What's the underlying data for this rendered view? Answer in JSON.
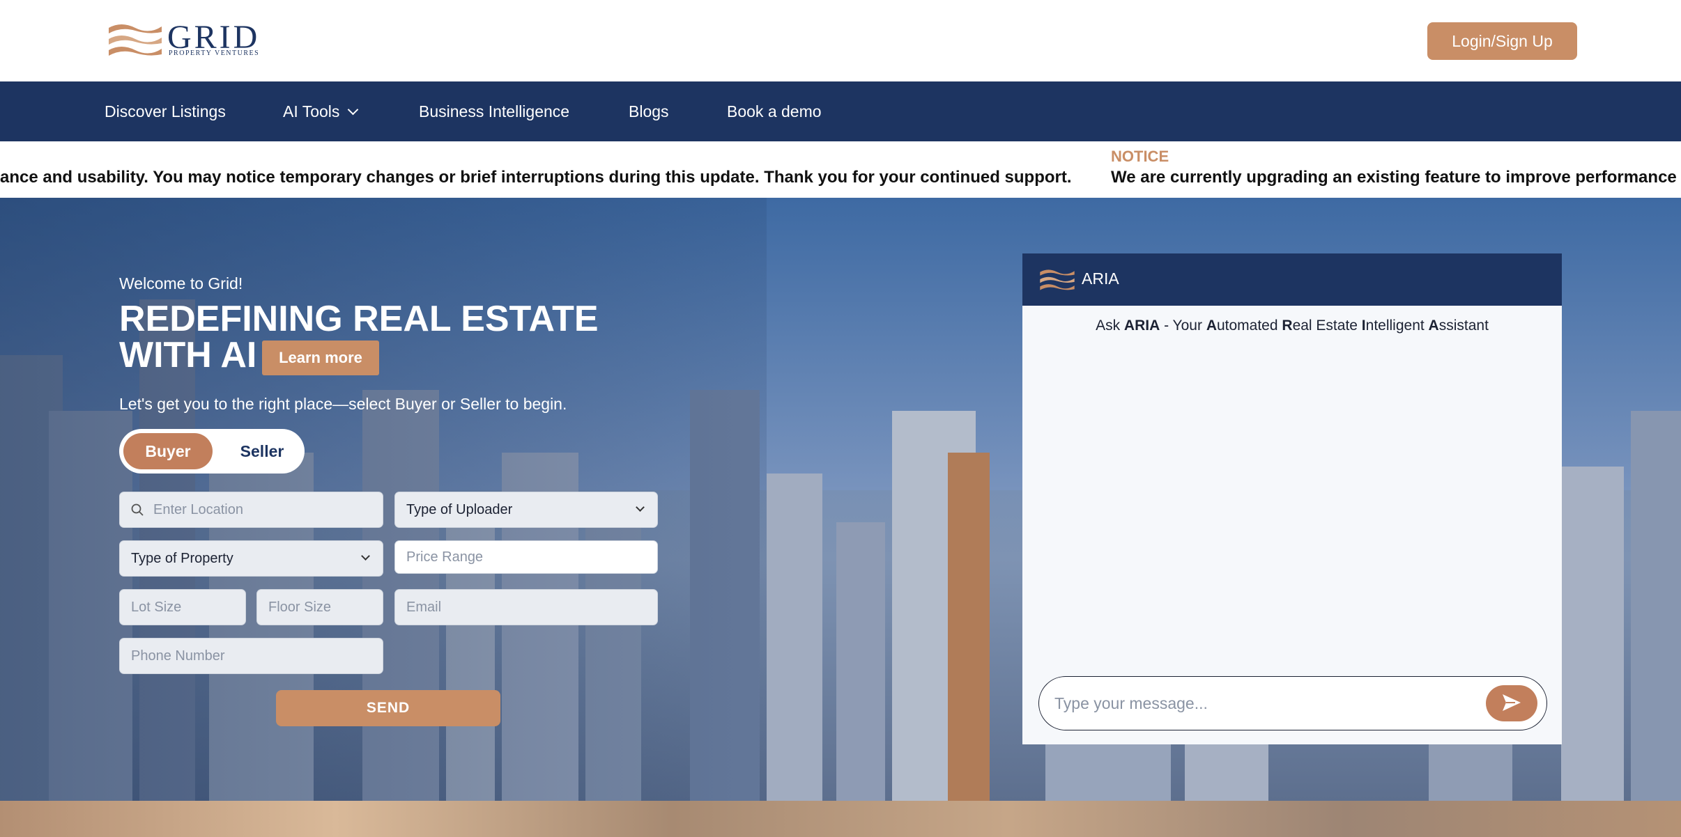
{
  "header": {
    "logo_text": "GRID",
    "logo_subtext": "PROPERTY VENTURES",
    "login_label": "Login/Sign Up"
  },
  "nav": {
    "items": [
      {
        "label": "Discover Listings"
      },
      {
        "label": "AI Tools"
      },
      {
        "label": "Business Intelligence"
      },
      {
        "label": "Blogs"
      },
      {
        "label": "Book a demo"
      }
    ]
  },
  "notice": {
    "label": "NOTICE",
    "text_tail": "ance and usability. You may notice temporary changes or brief interruptions during this update. Thank you for your continued support.",
    "text_head": "We are currently upgrading an existing feature to improve performance and"
  },
  "hero": {
    "welcome": "Welcome to Grid!",
    "headline_line1": "REDEFINING REAL ESTATE",
    "headline_line2": "WITH AI",
    "learn_more_label": "Learn more",
    "lead": "Let's get you to the right place—select Buyer or Seller to begin.",
    "toggle": {
      "buyer": "Buyer",
      "seller": "Seller",
      "selected": "Buyer"
    }
  },
  "form": {
    "location_placeholder": "Enter Location",
    "uploader_value": "Type of Uploader",
    "property_value": "Type of Property",
    "price_placeholder": "Price Range",
    "lot_placeholder": "Lot Size",
    "floor_placeholder": "Floor Size",
    "email_placeholder": "Email",
    "phone_placeholder": "Phone Number",
    "send_label": "SEND"
  },
  "chat": {
    "title": "ARIA",
    "subtitle_prefix": "Ask ",
    "subtitle_name": "ARIA",
    "subtitle_dash": " - Your ",
    "subtitle_parts": [
      {
        "bold": "A",
        "rest": "utomated "
      },
      {
        "bold": "R",
        "rest": "eal Estate "
      },
      {
        "bold": "I",
        "rest": "ntelligent "
      },
      {
        "bold": "A",
        "rest": "ssistant"
      }
    ],
    "input_placeholder": "Type your message..."
  },
  "colors": {
    "navy": "#1d3461",
    "accent": "#c98e66",
    "toggle_accent": "#c27f5c"
  }
}
